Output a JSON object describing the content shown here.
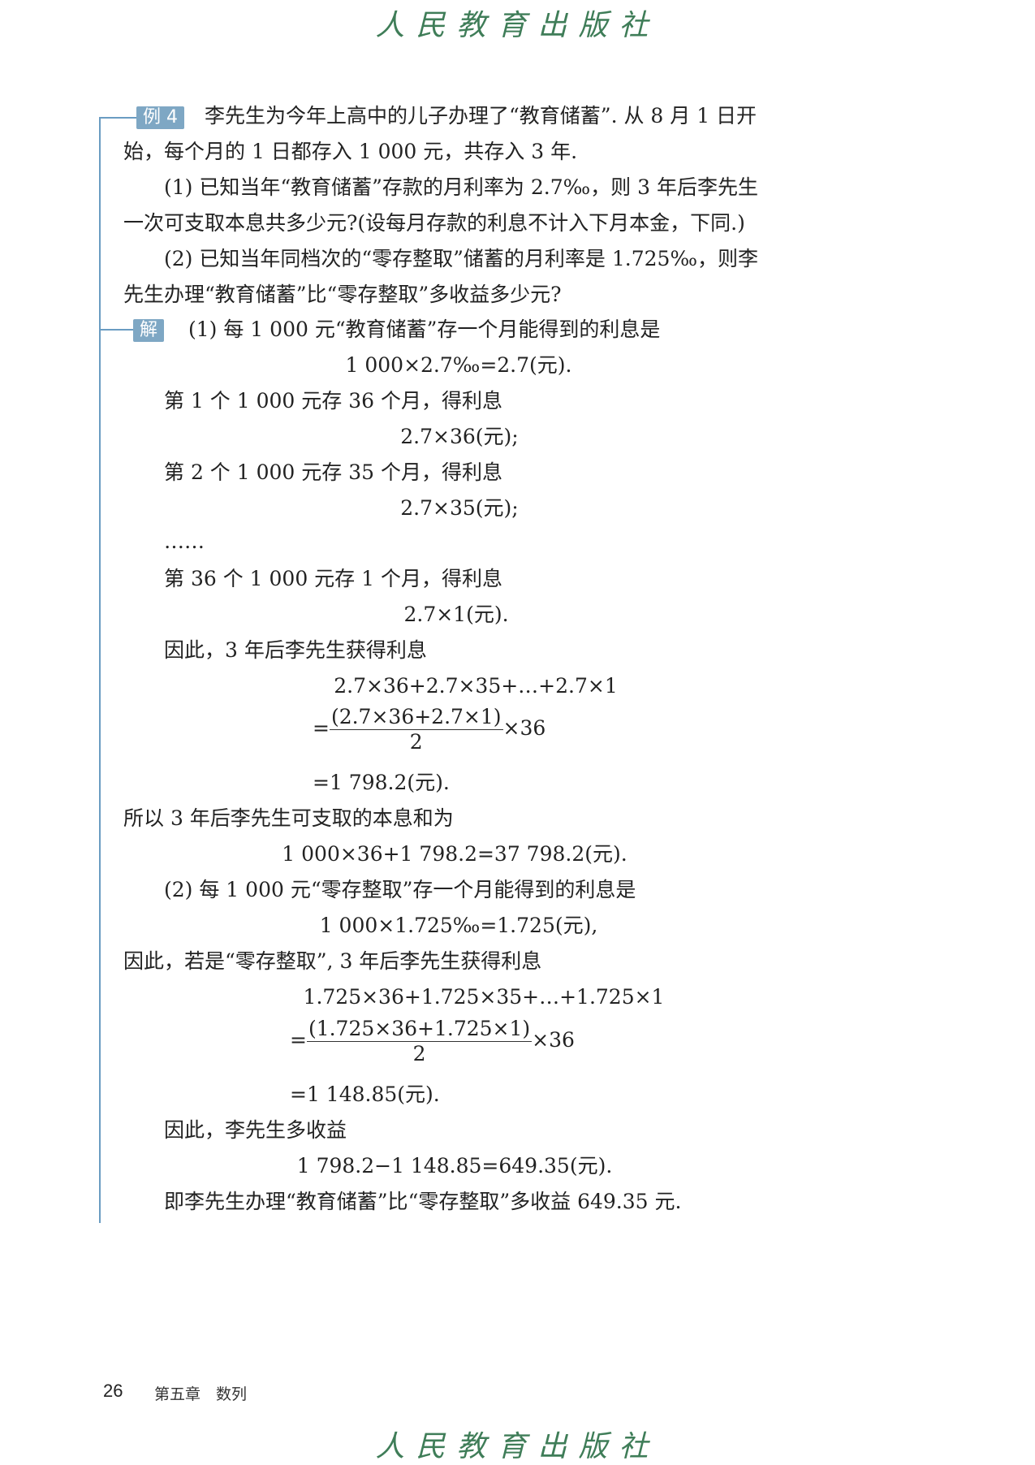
{
  "header": {
    "publisher": "人民教育出版社"
  },
  "example": {
    "tag": "例 4",
    "line1": "李先生为今年上高中的儿子办理了“教育储蓄”. 从 8 月 1 日开",
    "line2": "始，每个月的 1 日都存入 1 000 元，共存入 3 年.",
    "q1_line1": "(1) 已知当年“教育储蓄”存款的月利率为 2.7‰，则 3 年后李先生",
    "q1_line2": "一次可支取本息共多少元?(设每月存款的利息不计入下月本金，下同.)",
    "q2_line1": "(2) 已知当年同档次的“零存整取”储蓄的月利率是 1.725‰，则李",
    "q2_line2": "先生办理“教育储蓄”比“零存整取”多收益多少元?"
  },
  "solution": {
    "tag": "解",
    "s1": "(1) 每 1 000 元“教育储蓄”存一个月能得到的利息是",
    "e1": "1 000×2.7‰=2.7(元).",
    "s2": "第 1 个 1 000 元存 36 个月，得利息",
    "e2": "2.7×36(元);",
    "s3": "第 2 个 1 000 元存 35 个月，得利息",
    "e3": "2.7×35(元);",
    "dots": "……",
    "s4": "第 36 个 1 000 元存 1 个月，得利息",
    "e4": "2.7×1(元).",
    "s5": "因此，3 年后李先生获得利息",
    "e5": "2.7×36+2.7×35+…+2.7×1",
    "e6_eq": "=",
    "e6_num": "(2.7×36+2.7×1)",
    "e6_den": "2",
    "e6_tail": "×36",
    "e7": "=1 798.2(元).",
    "s6": "所以 3 年后李先生可支取的本息和为",
    "e8": "1 000×36+1 798.2=37 798.2(元).",
    "s7": "(2) 每 1 000 元“零存整取”存一个月能得到的利息是",
    "e9": "1 000×1.725‰=1.725(元),",
    "s8": "因此，若是“零存整取”, 3 年后李先生获得利息",
    "e10": "1.725×36+1.725×35+…+1.725×1",
    "e11_eq": "=",
    "e11_num": "(1.725×36+1.725×1)",
    "e11_den": "2",
    "e11_tail": "×36",
    "e12": "=1 148.85(元).",
    "s9": "因此，李先生多收益",
    "e13": "1 798.2−1 148.85=649.35(元).",
    "s10": "即李先生办理“教育储蓄”比“零存整取”多收益 649.35 元."
  },
  "footer": {
    "page": "26",
    "chapter": "第五章　数列",
    "publisher": "人民教育出版社"
  }
}
